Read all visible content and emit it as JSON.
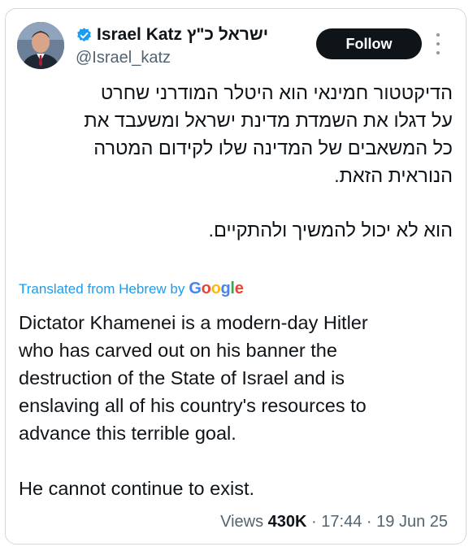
{
  "author": {
    "display_name": "Israel Katz ישראל כ\"ץ",
    "handle": "@Israel_katz",
    "verified_icon": "verified-badge-icon"
  },
  "actions": {
    "follow_label": "Follow",
    "more_icon": "more-dots-icon"
  },
  "post": {
    "hebrew_lines": [
      "הדיקטטור חמינאי הוא היטלר המודרני שחרט",
      "על דגלו את השמדת מדינת ישראל ומשעבד את",
      "כל המשאבים של המדינה שלו לקידום המטרה",
      "הנוראית הזאת.",
      "הוא לא יכול להמשיך ולהתקיים."
    ],
    "translation_note": "Translated from Hebrew by",
    "translation_provider": "Google",
    "english_lines": [
      "Dictator Khamenei is a modern-day Hitler",
      "who has carved out on his banner the",
      "destruction of the State of Israel and is",
      "enslaving all of his country's resources to",
      "advance this terrible goal.",
      "He cannot continue to exist."
    ]
  },
  "meta": {
    "views_label": "Views",
    "views_count": "430K",
    "separator": "·",
    "time": "17:44",
    "date": "19 Jun 25"
  },
  "colors": {
    "accent_blue": "#1d9bf0",
    "text_primary": "#0f1419",
    "text_secondary": "#536471",
    "button_bg": "#0f1419"
  }
}
